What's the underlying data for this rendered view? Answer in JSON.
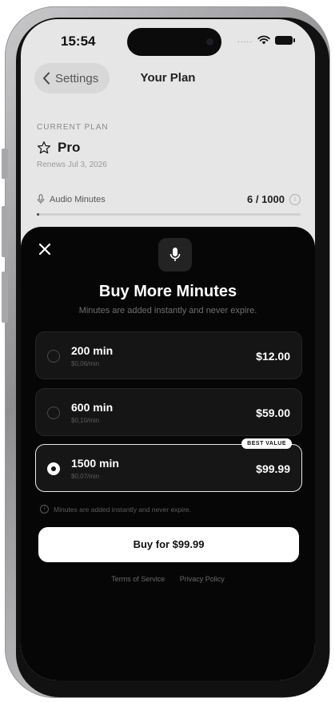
{
  "status_bar": {
    "time": "15:54",
    "signal": "....."
  },
  "nav": {
    "back_label": "Settings",
    "title": "Your Plan"
  },
  "plan": {
    "section_label": "CURRENT PLAN",
    "name": "Pro",
    "renews": "Renews Jul 3, 2026",
    "usage_label": "Audio Minutes",
    "usage_value": "6 / 1000",
    "usage_fraction": 0.006
  },
  "sheet": {
    "title": "Buy More Minutes",
    "subtitle": "Minutes are added instantly and never expire.",
    "options": [
      {
        "minutes": "200 min",
        "rate": "$0,06/min",
        "price": "$12.00",
        "selected": false
      },
      {
        "minutes": "600 min",
        "rate": "$0,10/min",
        "price": "$59.00",
        "selected": false
      },
      {
        "minutes": "1500 min",
        "rate": "$0,07/min",
        "price": "$99.99",
        "selected": true,
        "badge": "BEST VALUE"
      }
    ],
    "note": "Minutes are added instantly and never expire.",
    "buy_label": "Buy for $99.99",
    "terms_label": "Terms of Service",
    "privacy_label": "Privacy Policy"
  }
}
